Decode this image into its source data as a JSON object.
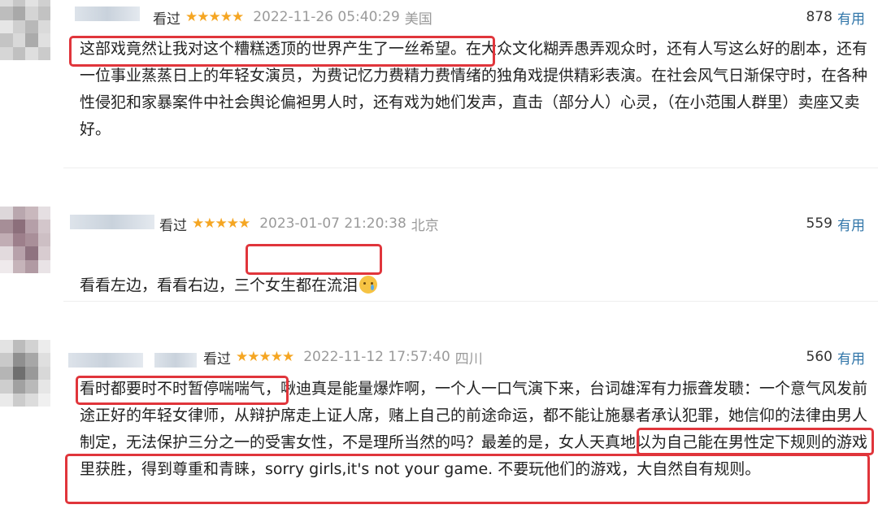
{
  "reviews": [
    {
      "status": "看过",
      "stars": "★★★★★",
      "rating": 5,
      "date": "2022-11-26 05:40:29",
      "location": "美国",
      "votes": "878",
      "useful_label": "有用",
      "text": "这部戏竟然让我对这个糟糕透顶的世界产生了一丝希望。在大众文化糊弄愚弄观众时，还有人写这么好的剧本，还有一位事业蒸蒸日上的年轻女演员，为费记忆力费精力费情绪的独角戏提供精彩表演。在社会风气日渐保守时，在各种性侵犯和家暴案件中社会舆论偏袒男人时，还有戏为她们发声，直击（部分人）心灵，（在小范围人群里）卖座又卖好。"
    },
    {
      "status": "看过",
      "stars": "★★★★★",
      "rating": 5,
      "date": "2023-01-07 21:20:38",
      "location": "北京",
      "votes": "559",
      "useful_label": "有用",
      "text": "看看左边，看看右边，三个女生都在流泪"
    },
    {
      "status": "看过",
      "stars": "★★★★★",
      "rating": 5,
      "date": "2022-11-12 17:57:40",
      "location": "四川",
      "votes": "560",
      "useful_label": "有用",
      "text": "看时都要时不时暂停喘喘气，啾迪真是能量爆炸啊，一个人一口气演下来，台词雄浑有力振聋发聩：一个意气风发前途正好的年轻女律师，从辩护席走上证人席，赌上自己的前途命运，都不能让施暴者承认犯罪，她信仰的法律由男人制定，无法保护三分之一的受害女性，不是理所当然的吗？最差的是，女人天真地以为自己能在男性定下规则的游戏里获胜，得到尊重和青睐，sorry girls,it's not your game. 不要玩他们的游戏，大自然自有规则。"
    }
  ]
}
